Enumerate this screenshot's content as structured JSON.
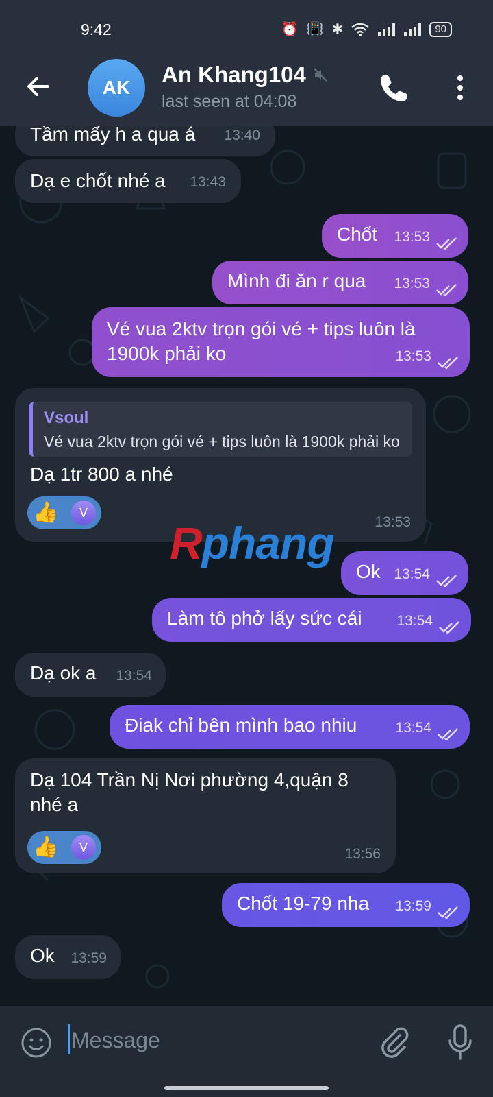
{
  "status_bar": {
    "time": "9:42",
    "battery": "90"
  },
  "header": {
    "avatar_initials": "AK",
    "contact_name": "An Khang104",
    "last_seen": "last seen at 04:08"
  },
  "messages": [
    {
      "dir": "in",
      "text": "Tầm mấy h a qua á",
      "time": "13:40"
    },
    {
      "dir": "in",
      "text": "Dạ e chốt nhé a",
      "time": "13:43"
    },
    {
      "dir": "out",
      "text": "Chốt",
      "time": "13:53"
    },
    {
      "dir": "out",
      "text": "Mình đi ăn r qua",
      "time": "13:53"
    },
    {
      "dir": "out",
      "text": "Vé vua 2ktv trọn gói vé + tips luôn là 1900k phải ko",
      "time": "13:53"
    },
    {
      "dir": "in",
      "reply_name": "Vsoul",
      "reply_text": "Vé vua 2ktv trọn gói vé + tips luôn là 1900k phải ko",
      "text": "Dạ 1tr 800 a nhé",
      "time": "13:53",
      "reaction": {
        "emoji": "👍",
        "avatar": "V"
      }
    },
    {
      "dir": "out",
      "text": "Ok",
      "time": "13:54"
    },
    {
      "dir": "out",
      "text": "Làm tô phở lấy sức cái",
      "time": "13:54"
    },
    {
      "dir": "in",
      "text": "Dạ ok a",
      "time": "13:54"
    },
    {
      "dir": "out",
      "text": "Điak chỉ bên mình bao nhiu",
      "time": "13:54"
    },
    {
      "dir": "in",
      "text": "Dạ 104 Trần Nị Nơi phường 4,quận 8 nhé a",
      "time": "13:56",
      "reaction": {
        "emoji": "👍",
        "avatar": "V"
      }
    },
    {
      "dir": "out",
      "text": "Chốt 19-79 nha",
      "time": "13:59"
    },
    {
      "dir": "in",
      "text": "Ok",
      "time": "13:59"
    }
  ],
  "watermark": {
    "part1": "R",
    "part2": "phang"
  },
  "input": {
    "placeholder": "Message"
  },
  "colors": {
    "outgoing_bubble_top": "#a04fc8",
    "outgoing_bubble_bottom": "#6a55e6",
    "incoming_bubble": "#232c37",
    "accent": "#4d9cf0"
  }
}
